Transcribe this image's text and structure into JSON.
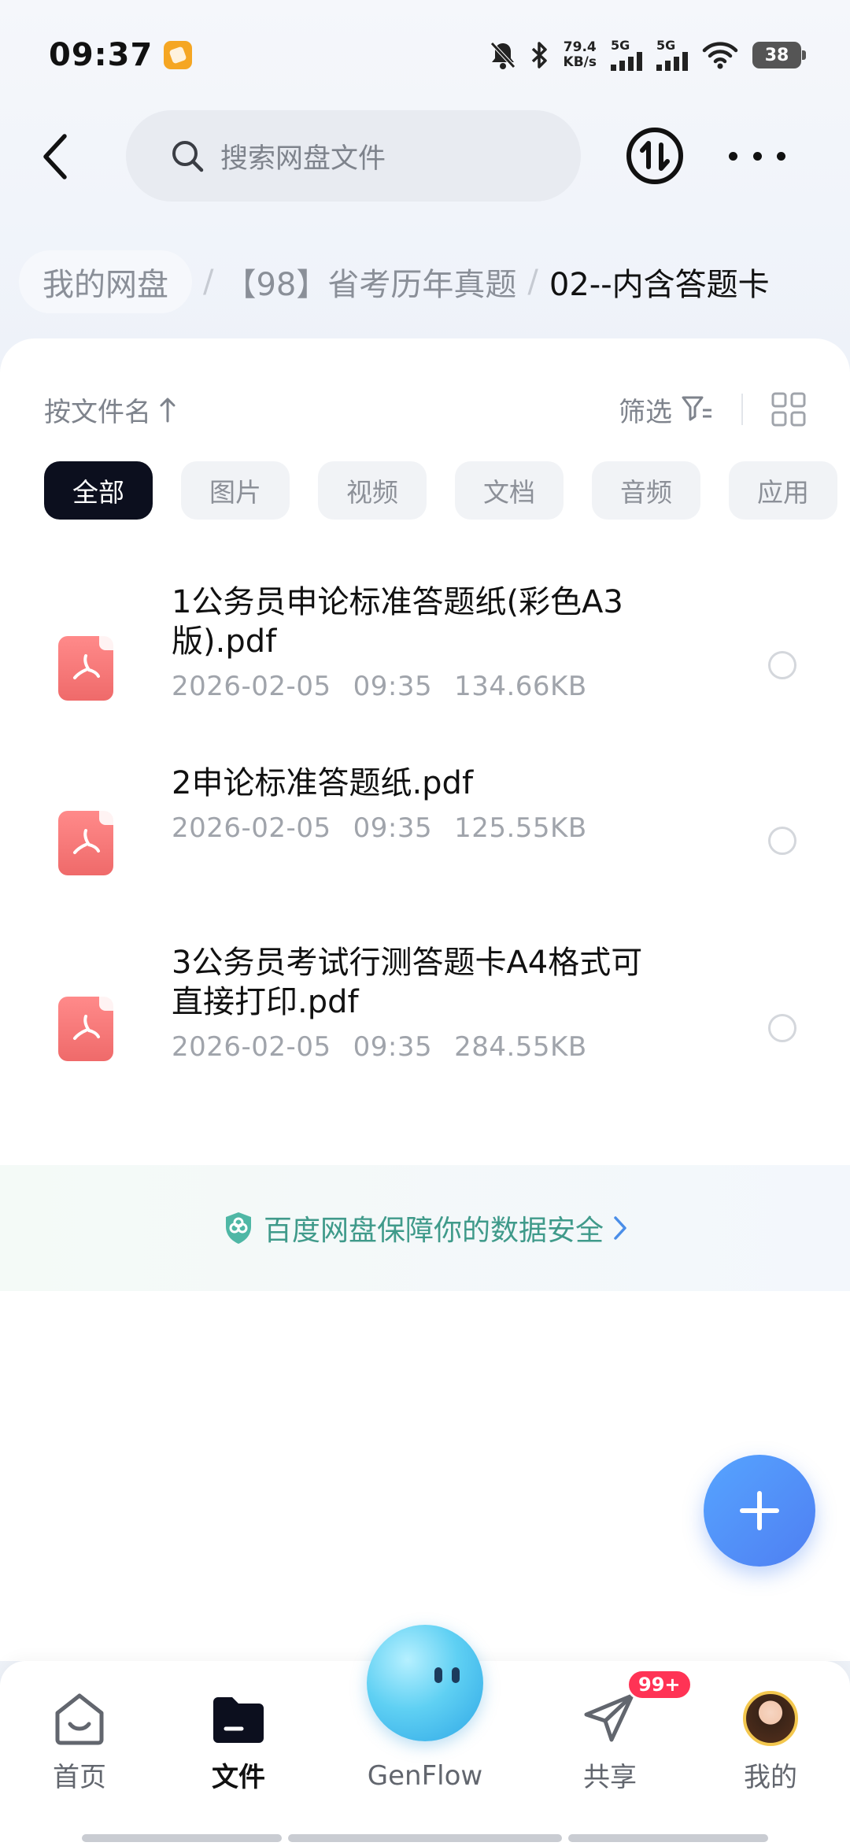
{
  "status_bar": {
    "time": "09:37",
    "net_speed_value": "79.4",
    "net_speed_unit": "KB/s",
    "signal1_label": "5G",
    "signal2_label": "5G",
    "battery": "38"
  },
  "header": {
    "search_placeholder": "搜索网盘文件"
  },
  "breadcrumb": {
    "root": "我的网盘",
    "parent": "【98】省考历年真题",
    "current": "02--内含答题卡"
  },
  "toolbar": {
    "sort_label": "按文件名",
    "filter_label": "筛选"
  },
  "tabs": [
    {
      "label": "全部",
      "active": true
    },
    {
      "label": "图片"
    },
    {
      "label": "视频"
    },
    {
      "label": "文档"
    },
    {
      "label": "音频"
    },
    {
      "label": "应用"
    }
  ],
  "files": [
    {
      "name_line1": "1公务员申论标准答题纸(彩色A3",
      "name_line2": "版).pdf",
      "date": "2026-02-05",
      "time": "09:35",
      "size": "134.66KB"
    },
    {
      "name_line1": "2申论标准答题纸.pdf",
      "name_line2": "",
      "date": "2026-02-05",
      "time": "09:35",
      "size": "125.55KB"
    },
    {
      "name_line1": "3公务员考试行测答题卡A4格式可",
      "name_line2": "直接打印.pdf",
      "date": "2026-02-05",
      "time": "09:35",
      "size": "284.55KB"
    }
  ],
  "safety_text": "百度网盘保障你的数据安全",
  "nav": {
    "home": "首页",
    "files": "文件",
    "genflow": "GenFlow",
    "share": "共享",
    "mine": "我的",
    "share_badge": "99+"
  },
  "colors": {
    "accent_blue": "#4f7ff2",
    "pdf_red": "#ef6a6a",
    "active_tab": "#0c0f1e",
    "safety_green": "#3f9a8a",
    "badge_red": "#ff3355"
  }
}
